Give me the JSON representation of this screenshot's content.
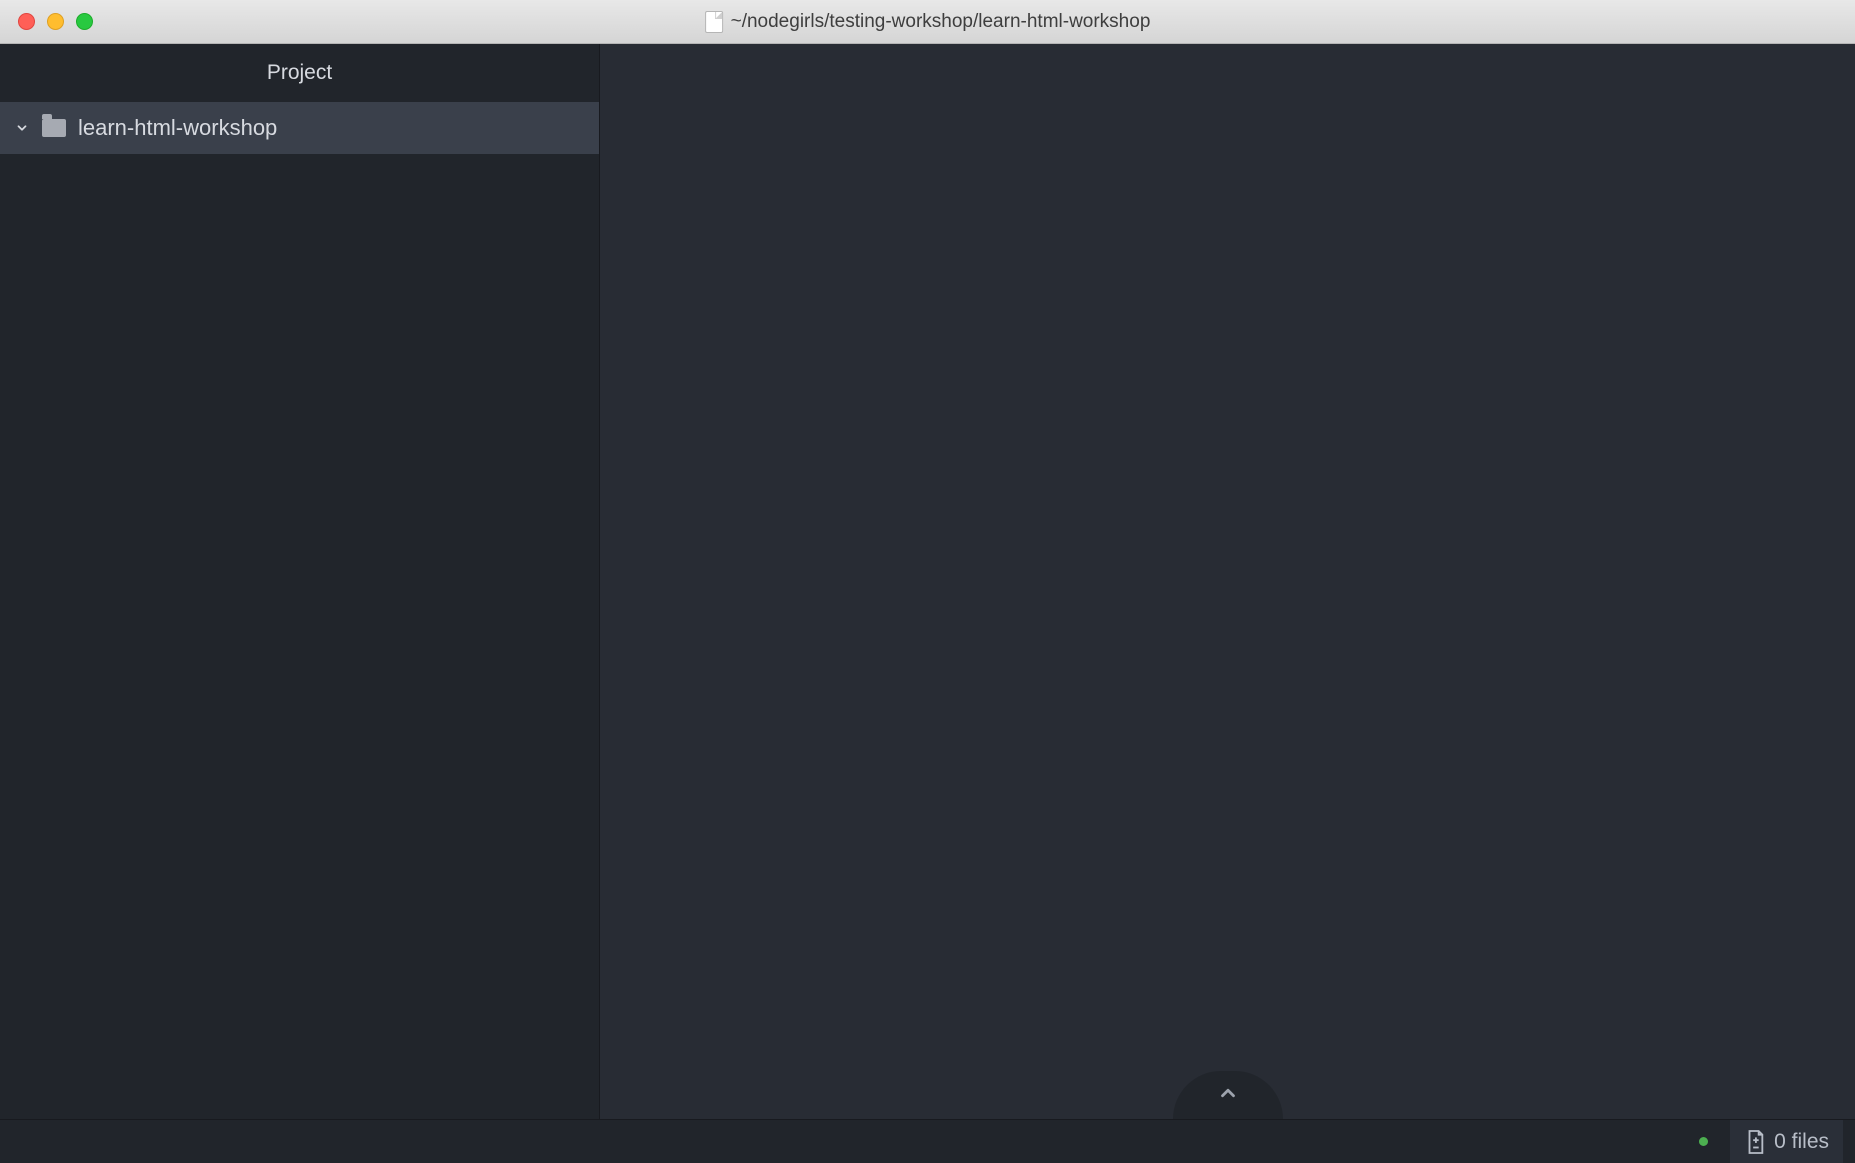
{
  "titlebar": {
    "path": "~/nodegirls/testing-workshop/learn-html-workshop"
  },
  "sidebar": {
    "header": "Project",
    "root": {
      "label": "learn-html-workshop"
    }
  },
  "statusbar": {
    "git_files": "0 files"
  },
  "icons": {
    "chevron_down": "chevron-down-icon",
    "chevron_up": "chevron-up-icon",
    "folder": "folder-icon",
    "file_page": "file-page-icon",
    "git_diff": "git-diff-icon"
  },
  "colors": {
    "bg_main": "#282c34",
    "bg_panel": "#21252b",
    "bg_selected": "#3a404b",
    "text": "#d7dae0",
    "traffic_red": "#ff5f57",
    "traffic_yellow": "#ffbd2e",
    "traffic_green": "#28c940",
    "status_dot": "#4caf50"
  }
}
